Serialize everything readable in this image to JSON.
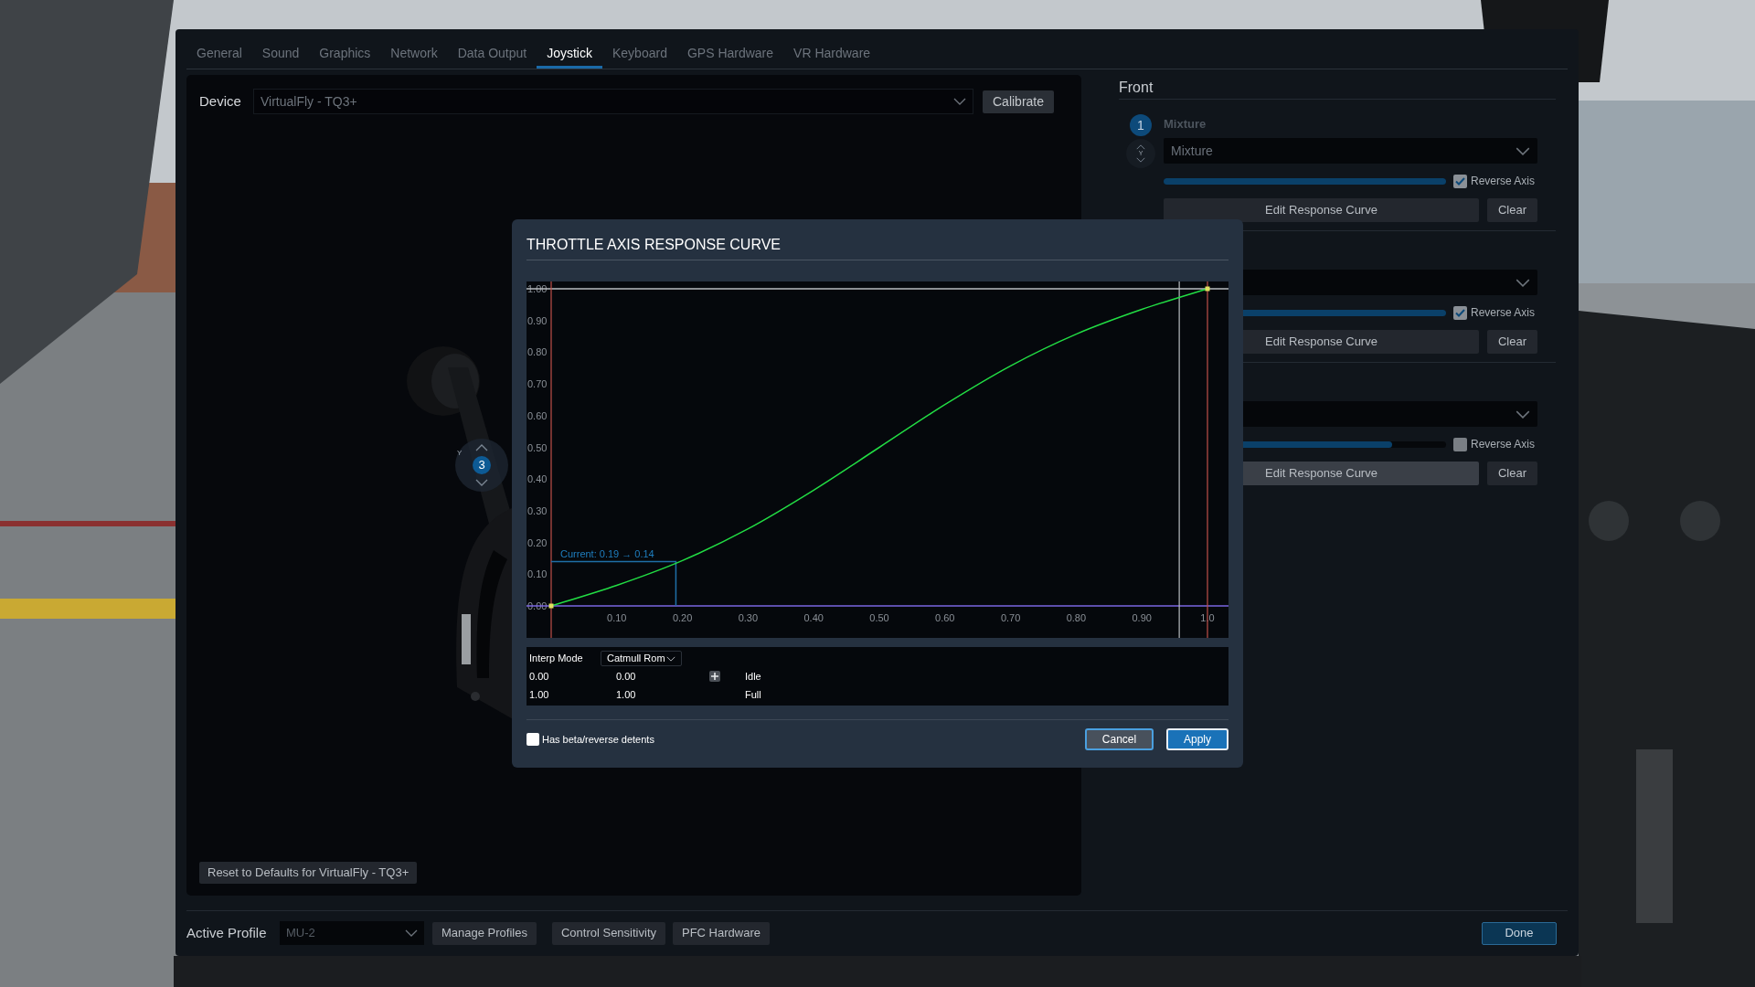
{
  "tabs": [
    {
      "label": "General",
      "selected": false
    },
    {
      "label": "Sound",
      "selected": false
    },
    {
      "label": "Graphics",
      "selected": false
    },
    {
      "label": "Network",
      "selected": false
    },
    {
      "label": "Data Output",
      "selected": false
    },
    {
      "label": "Joystick",
      "selected": true
    },
    {
      "label": "Keyboard",
      "selected": false
    },
    {
      "label": "GPS Hardware",
      "selected": false
    },
    {
      "label": "VR Hardware",
      "selected": false
    }
  ],
  "device": {
    "label": "Device",
    "value": "VirtualFly - TQ3+",
    "button": "Calibrate",
    "axis_badge": "3",
    "axis_letter": "Y",
    "reset_button": "Reset to Defaults for VirtualFly - TQ3+"
  },
  "right_panel": {
    "title": "Front",
    "axes": [
      {
        "number": "1",
        "label": "Mixture",
        "axis_letter": "Y",
        "value": "Mixture",
        "level": 1,
        "reverse_checked": true,
        "reverse_label": "Reverse Axis",
        "edit_button": "Edit Response Curve",
        "clear_button": "Clear",
        "highlighted": false
      },
      {
        "level": 1,
        "reverse_checked": true,
        "reverse_label": "Reverse Axis",
        "edit_button": "Edit Response Curve",
        "clear_button": "Clear",
        "highlighted": false
      },
      {
        "level": 0.81,
        "reverse_checked": false,
        "reverse_label": "Reverse Axis",
        "edit_button": "Edit Response Curve",
        "clear_button": "Clear",
        "highlighted": true
      }
    ]
  },
  "bottom_bar": {
    "profile_label": "Active Profile",
    "profile_value": "MU-2",
    "buttons": [
      "Manage Profiles",
      "Control Sensitivity",
      "PFC Hardware"
    ],
    "done_button": "Done"
  },
  "dialog": {
    "title": "THROTTLE AXIS RESPONSE CURVE",
    "chart_data": {
      "type": "line",
      "x": [
        0,
        0.1,
        0.2,
        0.3,
        0.4,
        0.5,
        0.6,
        0.7,
        0.8,
        0.9,
        1
      ],
      "series": [
        {
          "color": "#22dd44",
          "values": [
            0,
            0.065,
            0.143,
            0.243,
            0.365,
            0.5,
            0.635,
            0.757,
            0.857,
            0.935,
            1
          ]
        }
      ],
      "xlim": [
        0,
        1
      ],
      "ylim": [
        0,
        1
      ],
      "xticks": [
        {
          "value": 0.1,
          "label": "0.10"
        },
        {
          "value": 0.2,
          "label": "0.20"
        },
        {
          "value": 0.3,
          "label": "0.30"
        },
        {
          "value": 0.4,
          "label": "0.40"
        },
        {
          "value": 0.5,
          "label": "0.50"
        },
        {
          "value": 0.6,
          "label": "0.60"
        },
        {
          "value": 0.7,
          "label": "0.70"
        },
        {
          "value": 0.8,
          "label": "0.80"
        },
        {
          "value": 0.9,
          "label": "0.90"
        },
        {
          "value": 1,
          "label": "1.0"
        }
      ],
      "yticks": [
        {
          "value": 0,
          "label": "0.00"
        },
        {
          "value": 0.1,
          "label": "0.10"
        },
        {
          "value": 0.2,
          "label": "0.20"
        },
        {
          "value": 0.3,
          "label": "0.30"
        },
        {
          "value": 0.4,
          "label": "0.40"
        },
        {
          "value": 0.5,
          "label": "0.50"
        },
        {
          "value": 0.6,
          "label": "0.60"
        },
        {
          "value": 0.7,
          "label": "0.70"
        },
        {
          "value": 0.8,
          "label": "0.80"
        },
        {
          "value": 0.9,
          "label": "0.90"
        },
        {
          "value": 1,
          "label": "1.00"
        }
      ],
      "annotations": [
        {
          "x": 0.19,
          "y": 0.14,
          "text": "Current: 0.19 → 0.14"
        }
      ],
      "ref_lines": [
        {
          "axis": "x",
          "value": 0.957
        }
      ]
    },
    "interp": {
      "label": "Interp Mode",
      "value": "Catmull Rom"
    },
    "points": [
      {
        "input": "0.00",
        "output": "0.00",
        "name": "Idle",
        "add_button": true
      },
      {
        "input": "1.00",
        "output": "1.00",
        "name": "Full",
        "add_button": false
      }
    ],
    "detents": {
      "label": "Has beta/reverse detents",
      "checked": false
    },
    "buttons": [
      {
        "label": "Cancel",
        "kind": "secondary"
      },
      {
        "label": "Apply",
        "kind": "primary"
      }
    ]
  }
}
